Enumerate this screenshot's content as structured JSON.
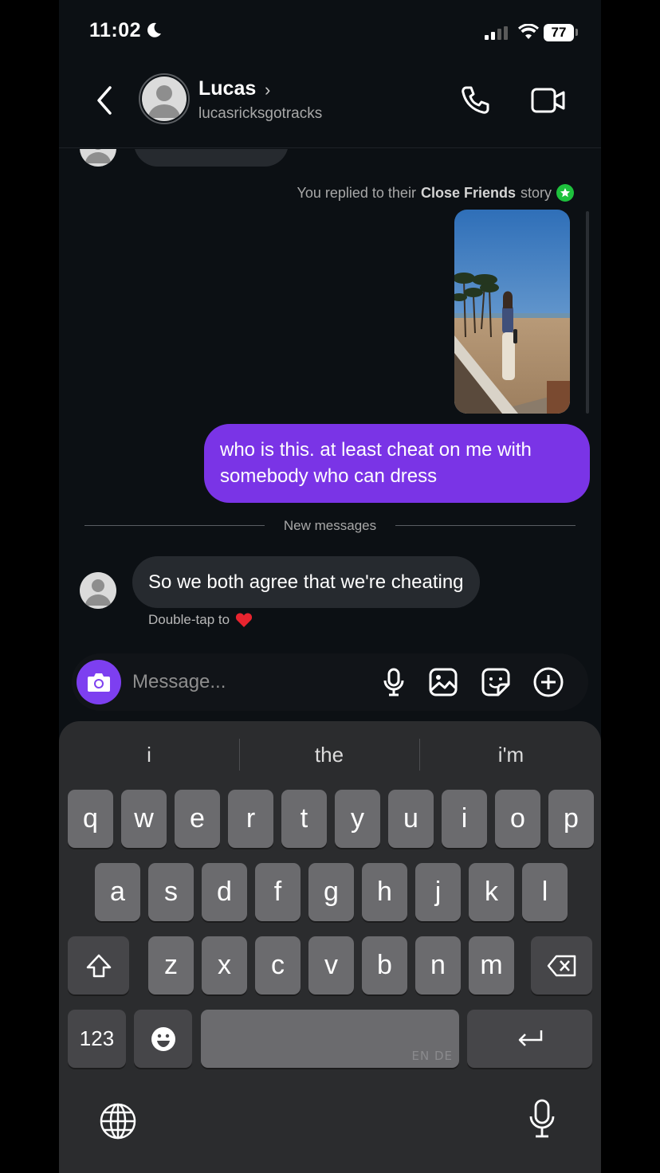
{
  "status_bar": {
    "time": "11:02",
    "battery": "77"
  },
  "header": {
    "name": "Lucas",
    "name_chevron": "›",
    "username": "lucasricksgotracks",
    "icons": [
      "back-icon",
      "avatar-placeholder-icon",
      "phone-icon",
      "video-camera-icon"
    ]
  },
  "chat": {
    "story_note": {
      "prefix": "You replied to their ",
      "highlight": "Close Friends",
      "suffix": " story"
    },
    "sent_message": "who is this. at least cheat on me with somebody who can dress",
    "separator": "New messages",
    "received_message": "So we both agree that we're cheating",
    "double_tap_hint": "Double-tap to",
    "reaction_emoji": "❤️"
  },
  "composer": {
    "placeholder": "Message...",
    "icons": [
      "camera-icon",
      "microphone-icon",
      "gallery-icon",
      "sticker-icon",
      "plus-icon"
    ]
  },
  "keyboard": {
    "suggestions": [
      "i",
      "the",
      "i'm"
    ],
    "row1": [
      "q",
      "w",
      "e",
      "r",
      "t",
      "y",
      "u",
      "i",
      "o",
      "p"
    ],
    "row2": [
      "a",
      "s",
      "d",
      "f",
      "g",
      "h",
      "j",
      "k",
      "l"
    ],
    "row3": [
      "z",
      "x",
      "c",
      "v",
      "b",
      "n",
      "m"
    ],
    "numbers_label": "123",
    "space_language": "EN DE"
  }
}
